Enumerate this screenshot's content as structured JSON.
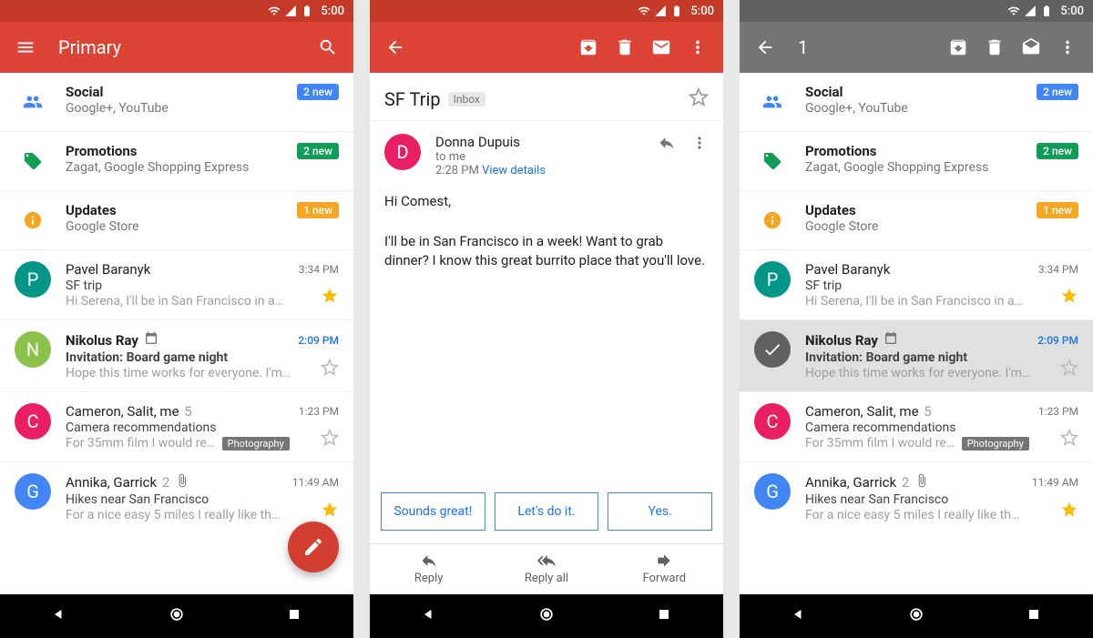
{
  "statusbar": {
    "time": "5:00"
  },
  "inbox": {
    "title": "Primary",
    "categories": [
      {
        "name": "Social",
        "sub": "Google+, YouTube",
        "badge": "2 new",
        "badge_color": "blue",
        "icon": "people",
        "icon_color": "#4285f4"
      },
      {
        "name": "Promotions",
        "sub": "Zagat, Google Shopping Express",
        "badge": "2 new",
        "badge_color": "green",
        "icon": "tag",
        "icon_color": "#0f9d58"
      },
      {
        "name": "Updates",
        "sub": "Google Store",
        "badge": "1 new",
        "badge_color": "amber",
        "icon": "info",
        "icon_color": "#f5a623"
      }
    ],
    "emails": [
      {
        "sender": "Pavel Baranyk",
        "subject": "SF trip",
        "snippet": "Hi Serena, I'll be in San Francisco in a…",
        "time": "3:34 PM",
        "avatar": "P",
        "avatar_color": "#009688",
        "starred": true,
        "unread": false
      },
      {
        "sender": "Nikolus Ray",
        "subject": "Invitation: Board game night",
        "snippet": "Hope this time works for everyone. I'm…",
        "time": "2:09 PM",
        "avatar": "N",
        "avatar_color": "#8bc34a",
        "starred": false,
        "unread": true,
        "calendar": true
      },
      {
        "sender": "Cameron, Salit, me",
        "count": "5",
        "subject": "Camera recommendations",
        "snippet": "For 35mm film I would re…",
        "chip": "Photography",
        "time": "1:23 PM",
        "avatar": "C",
        "avatar_color": "#e91e63",
        "starred": false,
        "unread": false
      },
      {
        "sender": "Annika, Garrick",
        "count": "2",
        "subject": "Hikes near San Francisco",
        "snippet": "For a nice easy 5 miles I really like th…",
        "time": "11:49 AM",
        "avatar": "G",
        "avatar_color": "#4285f4",
        "starred": true,
        "unread": false,
        "attachment": true
      }
    ]
  },
  "message": {
    "subject": "SF Trip",
    "folder": "Inbox",
    "from_name": "Donna Dupuis",
    "from_initial": "D",
    "to": "to me",
    "time": "2:28 PM",
    "details_label": "View details",
    "body": "Hi Comest,\n\nI'll be in San Francisco in a week! Want to grab dinner? I know this great burrito place that you'll love.",
    "smart_replies": [
      "Sounds great!",
      "Let's do it.",
      "Yes."
    ],
    "actions": {
      "reply": "Reply",
      "reply_all": "Reply all",
      "forward": "Forward"
    }
  },
  "selection": {
    "count": "1"
  }
}
